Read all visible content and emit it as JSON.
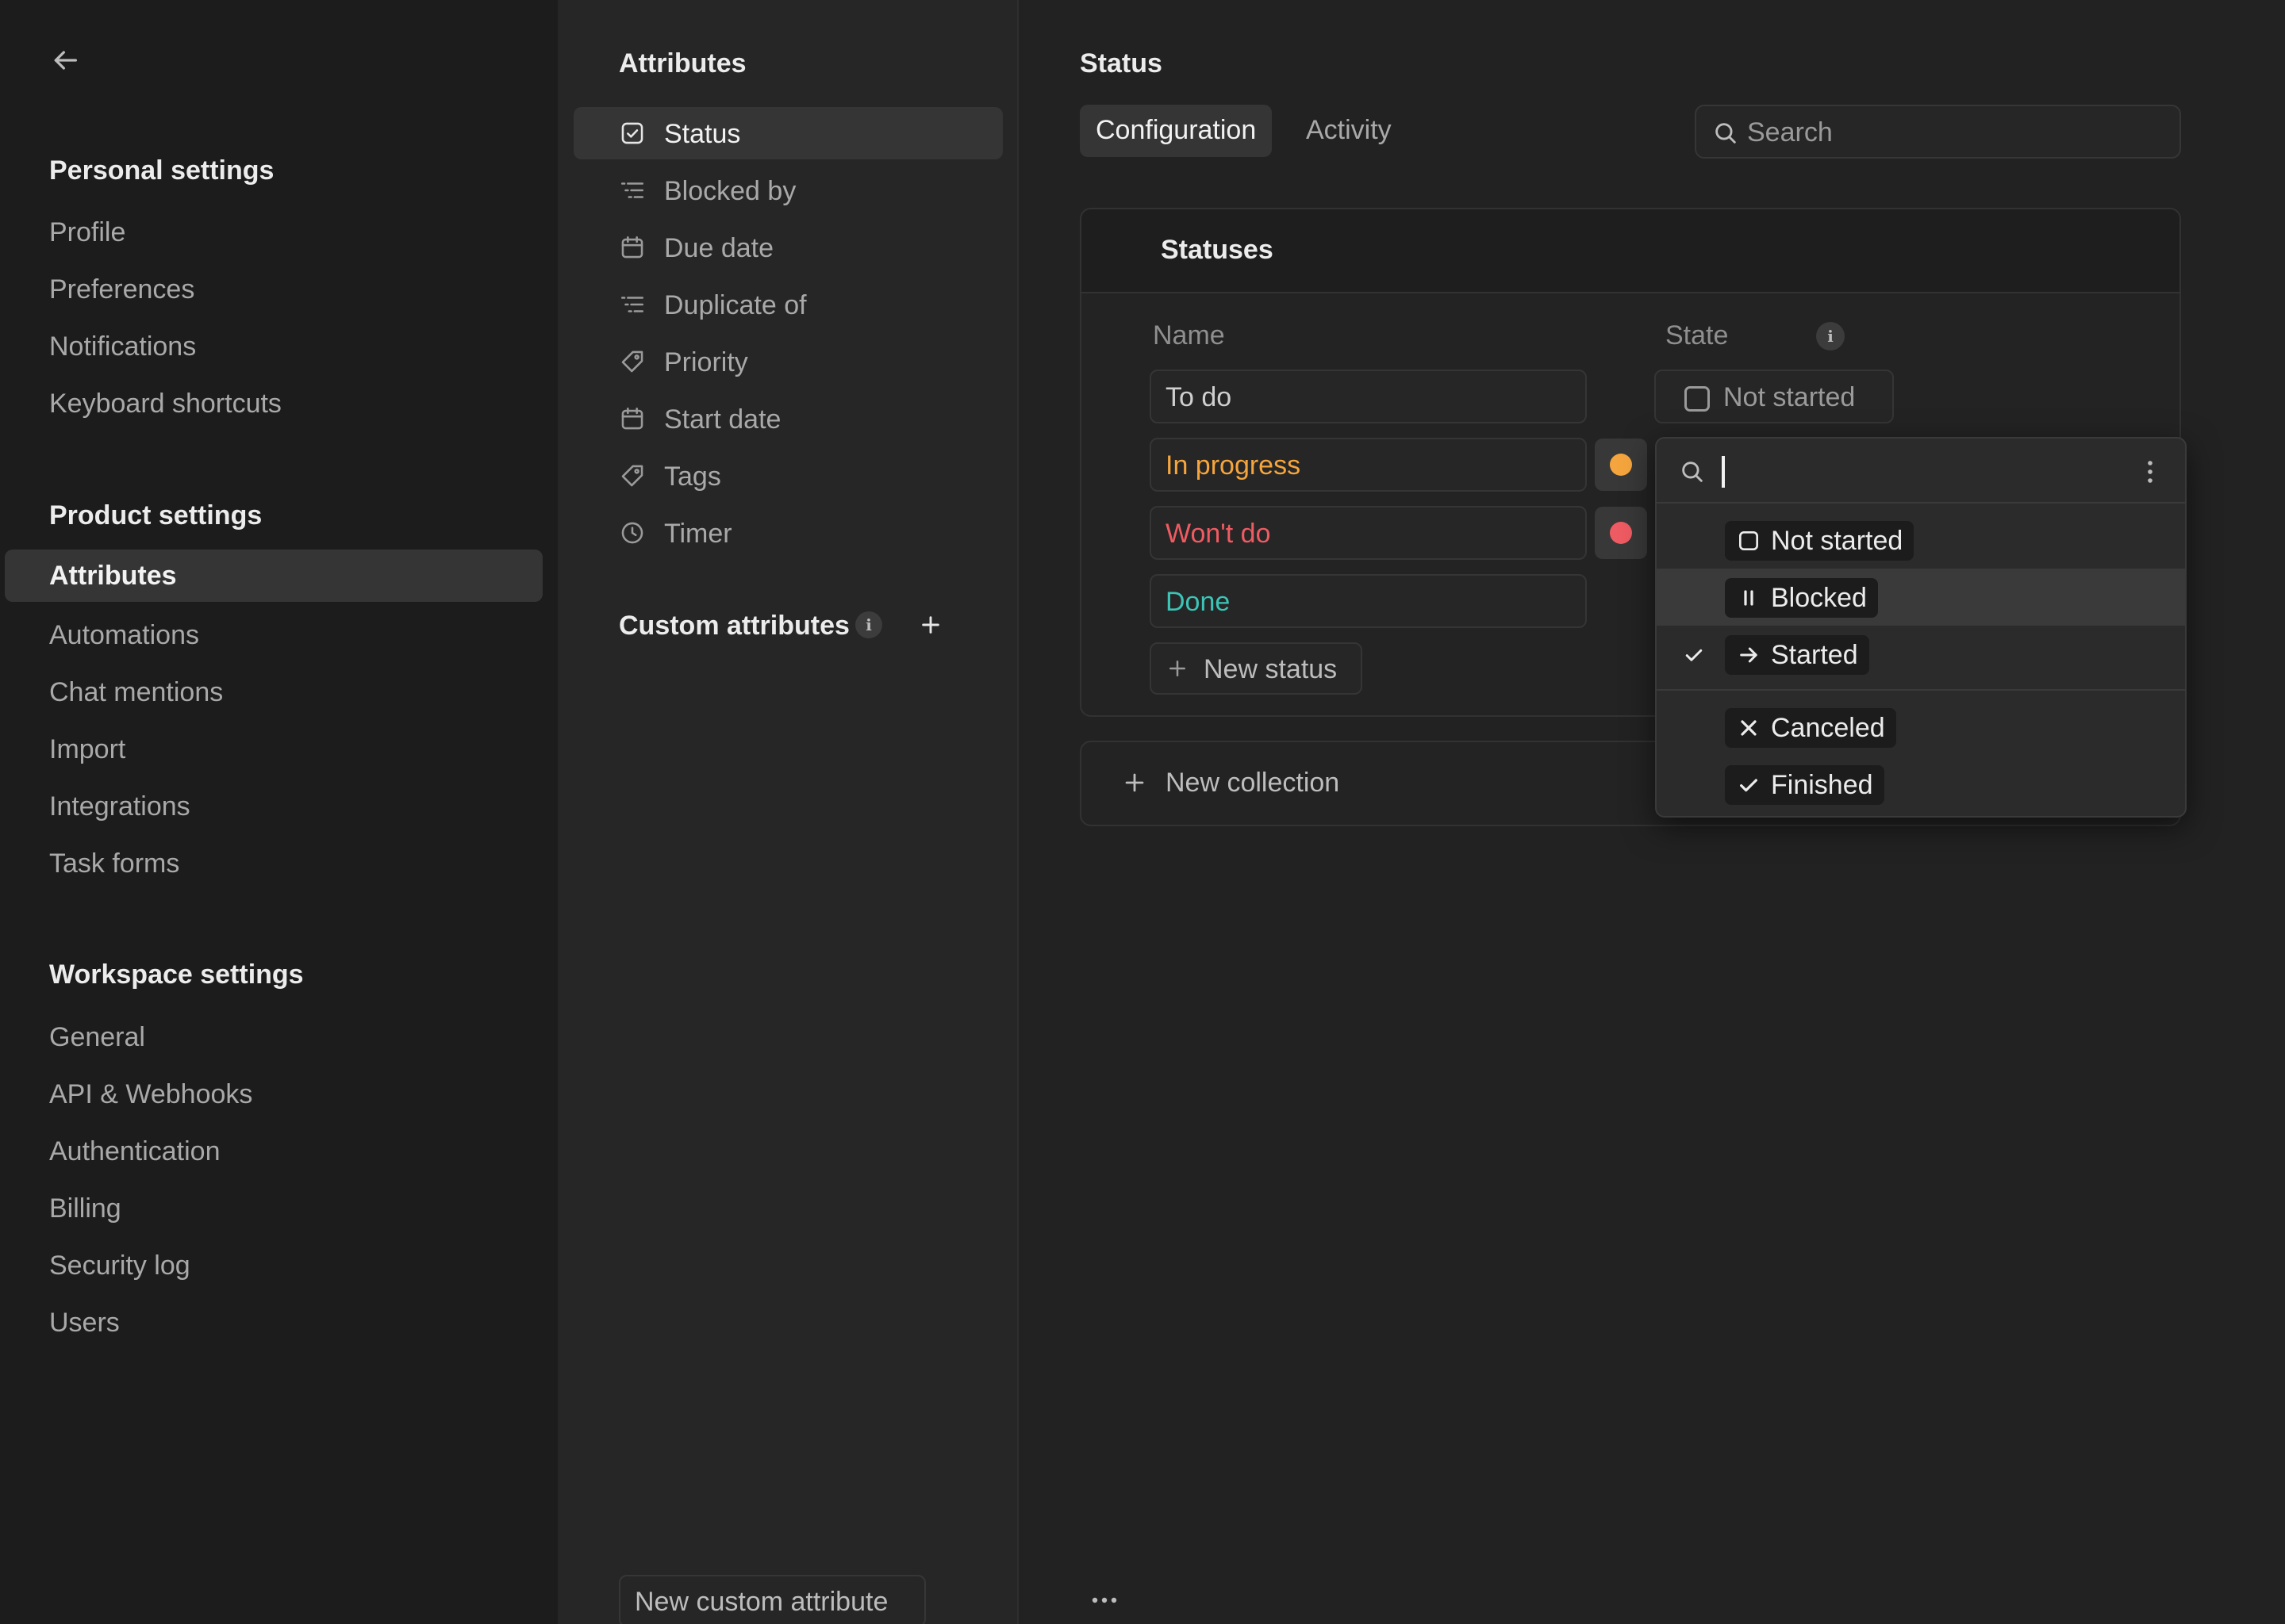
{
  "sidebar": {
    "personal_title": "Personal settings",
    "personal_items": [
      "Profile",
      "Preferences",
      "Notifications",
      "Keyboard shortcuts"
    ],
    "product_title": "Product settings",
    "product_items": [
      "Attributes",
      "Automations",
      "Chat mentions",
      "Import",
      "Integrations",
      "Task forms"
    ],
    "workspace_title": "Workspace settings",
    "workspace_items": [
      "General",
      "API & Webhooks",
      "Authentication",
      "Billing",
      "Security log",
      "Users"
    ]
  },
  "attributes": {
    "title": "Attributes",
    "items": [
      {
        "label": "Status",
        "icon": "check-square-icon"
      },
      {
        "label": "Blocked by",
        "icon": "relation-list-icon"
      },
      {
        "label": "Due date",
        "icon": "calendar-icon"
      },
      {
        "label": "Duplicate of",
        "icon": "relation-list-icon"
      },
      {
        "label": "Priority",
        "icon": "tag-icon"
      },
      {
        "label": "Start date",
        "icon": "calendar-icon"
      },
      {
        "label": "Tags",
        "icon": "tag-icon"
      },
      {
        "label": "Timer",
        "icon": "clock-icon"
      }
    ],
    "custom_title": "Custom attributes",
    "new_custom_label": "New custom attribute"
  },
  "main": {
    "title": "Status",
    "tabs": [
      "Configuration",
      "Activity"
    ],
    "search_placeholder": "Search",
    "card_title": "Statuses",
    "col_name": "Name",
    "col_state": "State",
    "statuses": [
      {
        "name": "To do",
        "color": "#cfcfcf"
      },
      {
        "name": "In progress",
        "color": "#f5a53d"
      },
      {
        "name": "Won't do",
        "color": "#ee5b62"
      },
      {
        "name": "Done",
        "color": "#3cc4b6"
      }
    ],
    "todo_state": "Not started",
    "new_status_label": "New status",
    "new_collection_label": "New collection"
  },
  "dropdown": {
    "search_value": "",
    "options": [
      {
        "label": "Not started",
        "icon": "square-icon",
        "selected": false
      },
      {
        "label": "Blocked",
        "icon": "pause-icon",
        "selected": false
      },
      {
        "label": "Started",
        "icon": "arrow-right-icon",
        "selected": true
      },
      {
        "label": "Canceled",
        "icon": "x-icon",
        "selected": false
      },
      {
        "label": "Finished",
        "icon": "check-icon",
        "selected": false
      }
    ]
  }
}
